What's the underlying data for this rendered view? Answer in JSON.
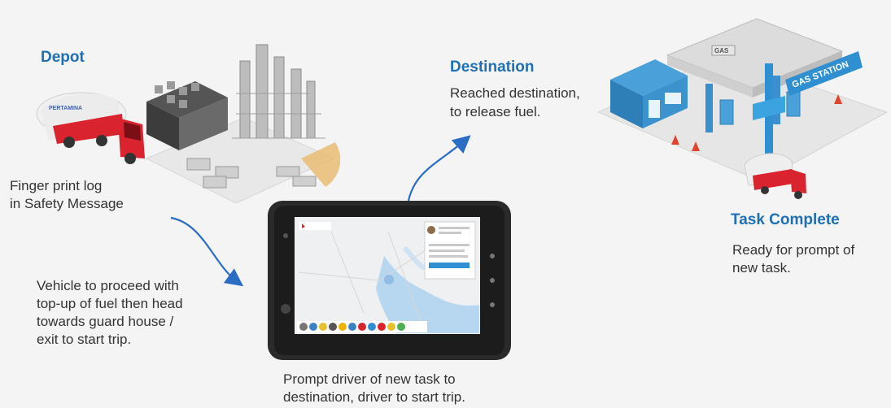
{
  "depot": {
    "title": "Depot",
    "fingerprint_text_1": "Finger print log",
    "fingerprint_text_2": "in Safety Message",
    "step_lines": [
      "Vehicle to proceed with",
      "top-up of fuel then head",
      "towards guard house /",
      "exit to start trip."
    ]
  },
  "destination": {
    "title": "Destination",
    "lines": [
      "Reached destination,",
      "to release fuel."
    ]
  },
  "task_complete": {
    "title": "Task Complete",
    "lines": [
      "Ready for prompt of",
      "new task."
    ]
  },
  "tablet": {
    "caption_lines": [
      "Prompt driver of new task to",
      "destination, driver to start trip."
    ]
  },
  "truck": {
    "brand_text": "PERTAMINA"
  },
  "station": {
    "sign_text": "GAS STATION",
    "canopy_text": "GAS"
  },
  "colors": {
    "heading": "#1f6fb5",
    "arrow": "#2b6cc4",
    "truck_red": "#d9232e",
    "station_blue": "#2f8fd0",
    "tablet_body": "#2a2a2a"
  }
}
